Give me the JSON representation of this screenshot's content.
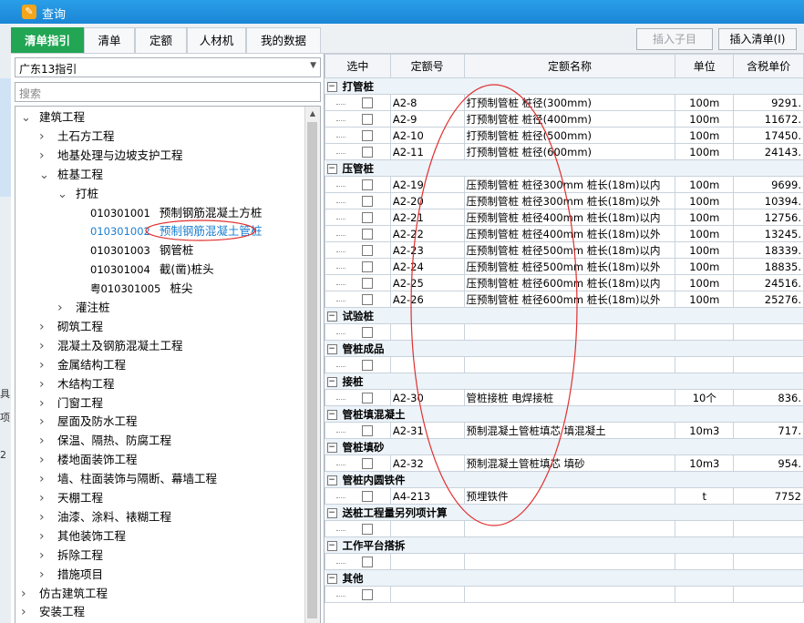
{
  "window": {
    "title": "查询"
  },
  "left_strip": {
    "s1": "具",
    "s2": "项",
    "s3": "2"
  },
  "tabs": [
    "清单指引",
    "清单",
    "定额",
    "人材机",
    "我的数据"
  ],
  "toolbar": {
    "insert_child": "插入子目",
    "insert_list": "插入清单(I)"
  },
  "combo": {
    "value": "广东13指引"
  },
  "search": {
    "placeholder": "搜索"
  },
  "tree": [
    {
      "label": "建筑工程",
      "level": 0,
      "toggle": "v"
    },
    {
      "label": "土石方工程",
      "level": 1,
      "toggle": ">"
    },
    {
      "label": "地基处理与边坡支护工程",
      "level": 1,
      "toggle": ">"
    },
    {
      "label": "桩基工程",
      "level": 1,
      "toggle": "v"
    },
    {
      "label": "打桩",
      "level": 2,
      "toggle": "v"
    },
    {
      "code": "010301001",
      "label": "预制钢筋混凝土方桩",
      "level": 3
    },
    {
      "code": "010301002",
      "label": "预制钢筋混凝土管桩",
      "level": 3,
      "selected": true
    },
    {
      "code": "010301003",
      "label": "钢管桩",
      "level": 3
    },
    {
      "code": "010301004",
      "label": "截(凿)桩头",
      "level": 3
    },
    {
      "code": "粤010301005",
      "label": "桩尖",
      "level": 3
    },
    {
      "label": "灌注桩",
      "level": 2,
      "toggle": ">"
    },
    {
      "label": "砌筑工程",
      "level": 1,
      "toggle": ">"
    },
    {
      "label": "混凝土及钢筋混凝土工程",
      "level": 1,
      "toggle": ">"
    },
    {
      "label": "金属结构工程",
      "level": 1,
      "toggle": ">"
    },
    {
      "label": "木结构工程",
      "level": 1,
      "toggle": ">"
    },
    {
      "label": "门窗工程",
      "level": 1,
      "toggle": ">"
    },
    {
      "label": "屋面及防水工程",
      "level": 1,
      "toggle": ">"
    },
    {
      "label": "保温、隔热、防腐工程",
      "level": 1,
      "toggle": ">"
    },
    {
      "label": "楼地面装饰工程",
      "level": 1,
      "toggle": ">"
    },
    {
      "label": "墙、柱面装饰与隔断、幕墙工程",
      "level": 1,
      "toggle": ">"
    },
    {
      "label": "天棚工程",
      "level": 1,
      "toggle": ">"
    },
    {
      "label": "油漆、涂料、裱糊工程",
      "level": 1,
      "toggle": ">"
    },
    {
      "label": "其他装饰工程",
      "level": 1,
      "toggle": ">"
    },
    {
      "label": "拆除工程",
      "level": 1,
      "toggle": ">"
    },
    {
      "label": "措施项目",
      "level": 1,
      "toggle": ">"
    },
    {
      "label": "仿古建筑工程",
      "level": 0,
      "toggle": ">"
    },
    {
      "label": "安装工程",
      "level": 0,
      "toggle": ">"
    }
  ],
  "grid": {
    "headers": [
      "选中",
      "定额号",
      "定额名称",
      "单位",
      "含税单价"
    ],
    "rows": [
      {
        "group": "打管桩"
      },
      {
        "code": "A2-8",
        "name": "打预制管桩 桩径(300mm)",
        "unit": "100m",
        "price": "9291."
      },
      {
        "code": "A2-9",
        "name": "打预制管桩 桩径(400mm)",
        "unit": "100m",
        "price": "11672."
      },
      {
        "code": "A2-10",
        "name": "打预制管桩 桩径(500mm)",
        "unit": "100m",
        "price": "17450."
      },
      {
        "code": "A2-11",
        "name": "打预制管桩 桩径(600mm)",
        "unit": "100m",
        "price": "24143."
      },
      {
        "group": "压管桩"
      },
      {
        "code": "A2-19",
        "name": "压预制管桩 桩径300mm 桩长(18m)以内",
        "unit": "100m",
        "price": "9699."
      },
      {
        "code": "A2-20",
        "name": "压预制管桩 桩径300mm 桩长(18m)以外",
        "unit": "100m",
        "price": "10394."
      },
      {
        "code": "A2-21",
        "name": "压预制管桩 桩径400mm 桩长(18m)以内",
        "unit": "100m",
        "price": "12756."
      },
      {
        "code": "A2-22",
        "name": "压预制管桩 桩径400mm 桩长(18m)以外",
        "unit": "100m",
        "price": "13245."
      },
      {
        "code": "A2-23",
        "name": "压预制管桩 桩径500mm 桩长(18m)以内",
        "unit": "100m",
        "price": "18339."
      },
      {
        "code": "A2-24",
        "name": "压预制管桩 桩径500mm 桩长(18m)以外",
        "unit": "100m",
        "price": "18835."
      },
      {
        "code": "A2-25",
        "name": "压预制管桩 桩径600mm 桩长(18m)以内",
        "unit": "100m",
        "price": "24516."
      },
      {
        "code": "A2-26",
        "name": "压预制管桩 桩径600mm 桩长(18m)以外",
        "unit": "100m",
        "price": "25276."
      },
      {
        "group": "试验桩"
      },
      {
        "code": "",
        "name": "",
        "unit": "",
        "price": ""
      },
      {
        "group": "管桩成品"
      },
      {
        "code": "",
        "name": "",
        "unit": "",
        "price": ""
      },
      {
        "group": "接桩"
      },
      {
        "code": "A2-30",
        "name": "管桩接桩 电焊接桩",
        "unit": "10个",
        "price": "836."
      },
      {
        "group": "管桩填混凝土"
      },
      {
        "code": "A2-31",
        "name": "预制混凝土管桩填芯 填混凝土",
        "unit": "10m3",
        "price": "717."
      },
      {
        "group": "管桩填砂"
      },
      {
        "code": "A2-32",
        "name": "预制混凝土管桩填芯 填砂",
        "unit": "10m3",
        "price": "954."
      },
      {
        "group": "管桩内圆铁件"
      },
      {
        "code": "A4-213",
        "name": "预埋铁件",
        "unit": "t",
        "price": "7752"
      },
      {
        "group": "送桩工程量另列项计算"
      },
      {
        "code": "",
        "name": "",
        "unit": "",
        "price": ""
      },
      {
        "group": "工作平台搭拆"
      },
      {
        "code": "",
        "name": "",
        "unit": "",
        "price": ""
      },
      {
        "group": "其他"
      },
      {
        "code": "",
        "name": "",
        "unit": "",
        "price": ""
      }
    ]
  },
  "colors": {
    "titlebar": "#1a86d6",
    "active_tab": "#22a654",
    "annotation": "#e03030",
    "selected_text": "#1a7fd0"
  }
}
